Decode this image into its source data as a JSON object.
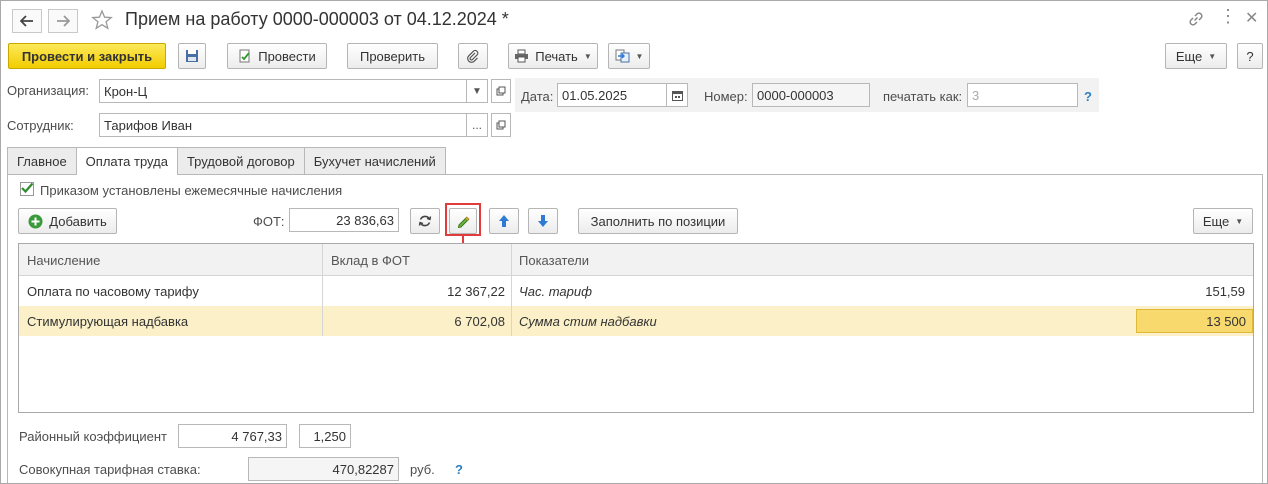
{
  "window": {
    "title": "Прием на работу 0000-000003 от 04.12.2024 *"
  },
  "toolbar": {
    "post_and_close": "Провести и закрыть",
    "post": "Провести",
    "check": "Проверить",
    "print": "Печать",
    "more": "Еще",
    "help": "?"
  },
  "header": {
    "organization_label": "Организация:",
    "organization_value": "Крон-Ц",
    "employee_label": "Сотрудник:",
    "employee_value": "Тарифов Иван",
    "date_label": "Дата:",
    "date_value": "01.05.2025",
    "number_label": "Номер:",
    "number_value": "0000-000003",
    "print_as_label": "печатать как:",
    "print_as_placeholder": "3",
    "help": "?"
  },
  "tabs": [
    {
      "label": "Главное",
      "active": false
    },
    {
      "label": "Оплата труда",
      "active": true
    },
    {
      "label": "Трудовой договор",
      "active": false
    },
    {
      "label": "Бухучет начислений",
      "active": false
    }
  ],
  "payment": {
    "monthly_accruals_checkbox_label": "Приказом установлены ежемесячные начисления",
    "monthly_accruals_checked": true,
    "add_button": "Добавить",
    "fot_label": "ФОТ:",
    "fot_value": "23 836,63",
    "fill_by_position": "Заполнить по позиции",
    "more": "Еще"
  },
  "table": {
    "columns": [
      "Начисление",
      "Вклад в ФОТ",
      "Показатели"
    ],
    "rows": [
      {
        "accrual": "Оплата по часовому тарифу",
        "contribution": "12 367,22",
        "indicator": "Час. тариф",
        "indicator_value": "151,59",
        "selected": false
      },
      {
        "accrual": "Стимулирующая надбавка",
        "contribution": "6 702,08",
        "indicator": "Сумма стим надбавки",
        "indicator_value": "13 500",
        "selected": true
      }
    ]
  },
  "footer": {
    "district_coef_label": "Районный коэффициент",
    "district_coef_amount": "4 767,33",
    "district_coef_value": "1,250",
    "total_rate_label": "Совокупная тарифная ставка:",
    "total_rate_value": "470,82287",
    "total_rate_unit": "руб.",
    "help": "?"
  },
  "colors": {
    "primary_button": "#f2cd00",
    "selected_row": "#fbf0c8",
    "selected_cell": "#f7d96e",
    "highlight_annotation": "#e23b3b",
    "help_link": "#2d7fc1"
  }
}
